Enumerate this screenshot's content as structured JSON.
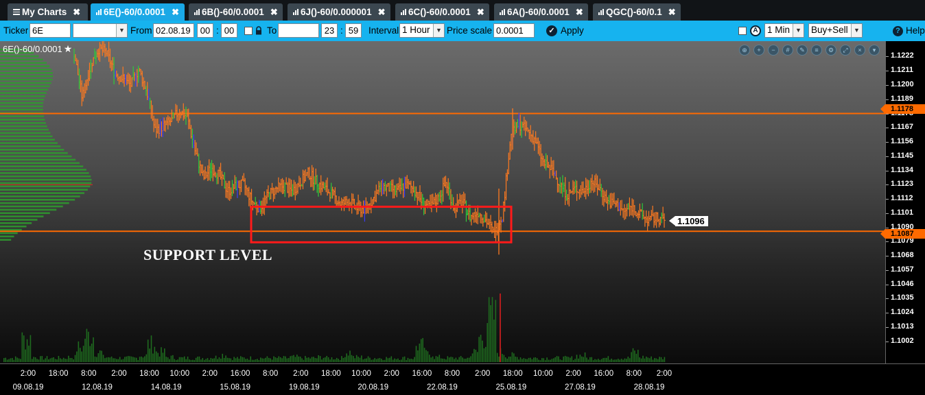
{
  "tabs": [
    {
      "label": "My Charts",
      "icon": "menu-icon",
      "active": false
    },
    {
      "label": "6E()-60/0.0001",
      "icon": "bar-chart-icon",
      "active": true
    },
    {
      "label": "6B()-60/0.0001",
      "icon": "bar-chart-icon",
      "active": false
    },
    {
      "label": "6J()-60/0.000001",
      "icon": "bar-chart-icon",
      "active": false
    },
    {
      "label": "6C()-60/0.0001",
      "icon": "bar-chart-icon",
      "active": false
    },
    {
      "label": "6A()-60/0.0001",
      "icon": "bar-chart-icon",
      "active": false
    },
    {
      "label": "QGC()-60/0.1",
      "icon": "bar-chart-icon",
      "active": false
    }
  ],
  "close_glyph": "✖",
  "toolbar": {
    "ticker_label": "Ticker",
    "ticker_value": "6E",
    "ticker_select": "",
    "from_label": "From",
    "from_date": "02.08.19",
    "from_hour": "00",
    "from_min": "00",
    "to_label": "To",
    "to_date": "",
    "to_hour": "23",
    "to_min": "59",
    "time_sep": ":",
    "interval_label": "Interval",
    "interval_value": "1 Hour",
    "price_scale_label": "Price scale",
    "price_scale_value": "0.0001",
    "apply_label": "Apply",
    "timeframe_value": "1 Min",
    "side_value": "Buy+Sell",
    "help_label": "Help"
  },
  "chart": {
    "title": "6E()-60/0.0001",
    "annotation": "SUPPORT LEVEL",
    "last_price_label": "1.1096",
    "resistance_label": "1.1178",
    "support_label": "1.1087",
    "colors": {
      "accent": "#ff6a00",
      "box": "#ff1a1a",
      "up": "#2fcc3a",
      "down": "#ff7a20",
      "profile": "#2e9e2e"
    }
  },
  "chart_data": {
    "type": "bar",
    "title": "6E()-60/0.0001",
    "price_ticks": [
      "1.1222",
      "1.1211",
      "1.1200",
      "1.1189",
      "1.1178",
      "1.1167",
      "1.1156",
      "1.1145",
      "1.1134",
      "1.1123",
      "1.1112",
      "1.1101",
      "1.1090",
      "1.1079",
      "1.1068",
      "1.1057",
      "1.1046",
      "1.1035",
      "1.1024",
      "1.1013",
      "1.1002"
    ],
    "time_ticks": [
      "2:00",
      "18:00",
      "8:00",
      "2:00",
      "18:00",
      "10:00",
      "2:00",
      "16:00",
      "8:00",
      "2:00",
      "18:00",
      "10:00",
      "2:00",
      "16:00",
      "8:00",
      "2:00",
      "18:00",
      "10:00",
      "2:00",
      "16:00",
      "8:00",
      "2:00"
    ],
    "date_ticks": [
      "09.08.19",
      "12.08.19",
      "14.08.19",
      "15.08.19",
      "19.08.19",
      "20.08.19",
      "22.08.19",
      "25.08.19",
      "27.08.19",
      "28.08.19"
    ],
    "ylim": [
      1.0995,
      1.1227
    ],
    "horizontal_lines": [
      1.1178,
      1.1087
    ],
    "support_zone": [
      1.1087,
      1.1106
    ],
    "last_price": 1.1096,
    "close_path": [
      1.1225,
      1.119,
      1.1215,
      1.1228,
      1.1225,
      1.121,
      1.1205,
      1.12,
      1.1212,
      1.1195,
      1.1165,
      1.1168,
      1.1172,
      1.118,
      1.1175,
      1.1148,
      1.1128,
      1.1136,
      1.113,
      1.1118,
      1.1122,
      1.1123,
      1.111,
      1.1105,
      1.1115,
      1.112,
      1.1122,
      1.1118,
      1.1125,
      1.1132,
      1.1125,
      1.112,
      1.1115,
      1.1108,
      1.111,
      1.1105,
      1.1104,
      1.1112,
      1.1122,
      1.112,
      1.1118,
      1.1123,
      1.112,
      1.111,
      1.1105,
      1.1112,
      1.1125,
      1.1105,
      1.111,
      1.1098,
      1.1102,
      1.1095,
      1.1085,
      1.11,
      1.116,
      1.117,
      1.1165,
      1.1158,
      1.114,
      1.1135,
      1.1125,
      1.1115,
      1.112,
      1.1118,
      1.1126,
      1.112,
      1.111,
      1.1108,
      1.1102,
      1.1106,
      1.11,
      1.1096,
      1.1097,
      1.1096
    ],
    "volume_peaks": [
      0.05,
      0.05,
      0.28,
      0.06,
      0.05,
      0.05,
      0.05,
      0.06,
      0.18,
      0.32,
      0.12,
      0.06,
      0.05,
      0.05,
      0.05,
      0.08,
      0.22,
      0.12,
      0.06,
      0.05,
      0.05,
      0.05,
      0.05,
      0.06,
      0.09,
      0.05,
      0.05,
      0.05,
      0.05,
      0.05,
      0.05,
      0.05,
      0.06,
      0.05,
      0.05,
      0.06,
      0.05,
      0.05,
      0.12,
      0.06,
      0.05,
      0.05,
      0.05,
      0.05,
      0.05,
      0.05,
      0.2,
      0.1,
      0.06,
      0.05,
      0.05,
      0.05,
      0.12,
      0.3,
      0.55,
      0.12,
      0.08,
      0.06,
      0.05,
      0.05,
      0.05,
      0.05,
      0.05,
      0.05,
      0.08,
      0.05,
      0.05,
      0.05,
      0.05,
      0.05,
      0.12,
      0.06,
      0.05,
      0.05
    ]
  }
}
